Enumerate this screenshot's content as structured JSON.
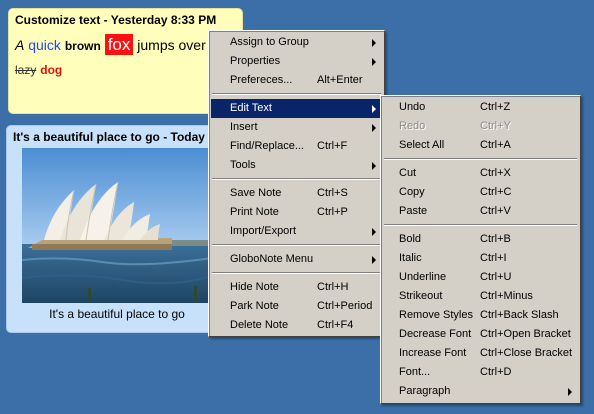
{
  "notes": {
    "customize": {
      "title": "Customize text - Yesterday 8:33 PM",
      "words": {
        "a": "A",
        "quick": "quick",
        "brown": "brown",
        "fox": "fox",
        "jumps_over": "jumps over",
        "lazy": "lazy",
        "dog": "dog"
      },
      "color": "#ffffbb"
    },
    "beautiful": {
      "title": "It's a beautiful place to go - Today 1",
      "caption": "It's a beautiful place to go",
      "color": "#c8e1fb"
    }
  },
  "main_menu": {
    "assign_to_group": "Assign to Group",
    "properties": "Properties",
    "preferences": "Prefereces...",
    "preferences_shortcut": "Alt+Enter",
    "edit_text": "Edit Text",
    "insert": "Insert",
    "find_replace": "Find/Replace...",
    "find_replace_shortcut": "Ctrl+F",
    "tools": "Tools",
    "save_note": "Save Note",
    "save_note_shortcut": "Ctrl+S",
    "print_note": "Print Note",
    "print_note_shortcut": "Ctrl+P",
    "import_export": "Import/Export",
    "globonote_menu": "GloboNote Menu",
    "hide_note": "Hide Note",
    "hide_note_shortcut": "Ctrl+H",
    "park_note": "Park Note",
    "park_note_shortcut": "Ctrl+Period",
    "delete_note": "Delete Note",
    "delete_note_shortcut": "Ctrl+F4"
  },
  "edit_text_menu": {
    "undo": "Undo",
    "undo_shortcut": "Ctrl+Z",
    "redo": "Redo",
    "redo_shortcut": "Ctrl+Y",
    "select_all": "Select All",
    "select_all_shortcut": "Ctrl+A",
    "cut": "Cut",
    "cut_shortcut": "Ctrl+X",
    "copy": "Copy",
    "copy_shortcut": "Ctrl+C",
    "paste": "Paste",
    "paste_shortcut": "Ctrl+V",
    "bold": "Bold",
    "bold_shortcut": "Ctrl+B",
    "italic": "Italic",
    "italic_shortcut": "Ctrl+I",
    "underline": "Underline",
    "underline_shortcut": "Ctrl+U",
    "strikeout": "Strikeout",
    "strikeout_shortcut": "Ctrl+Minus",
    "remove_styles": "Remove Styles",
    "remove_styles_shortcut": "Ctrl+Back Slash",
    "decrease_font": "Decrease Font",
    "decrease_font_shortcut": "Ctrl+Open Bracket",
    "increase_font": "Increase Font",
    "increase_font_shortcut": "Ctrl+Close Bracket",
    "font": "Font...",
    "font_shortcut": "Ctrl+D",
    "paragraph": "Paragraph"
  },
  "colors": {
    "desktop": "#3c6ea8",
    "menu_bg": "#d4d0c8",
    "menu_highlight": "#0a246a"
  }
}
